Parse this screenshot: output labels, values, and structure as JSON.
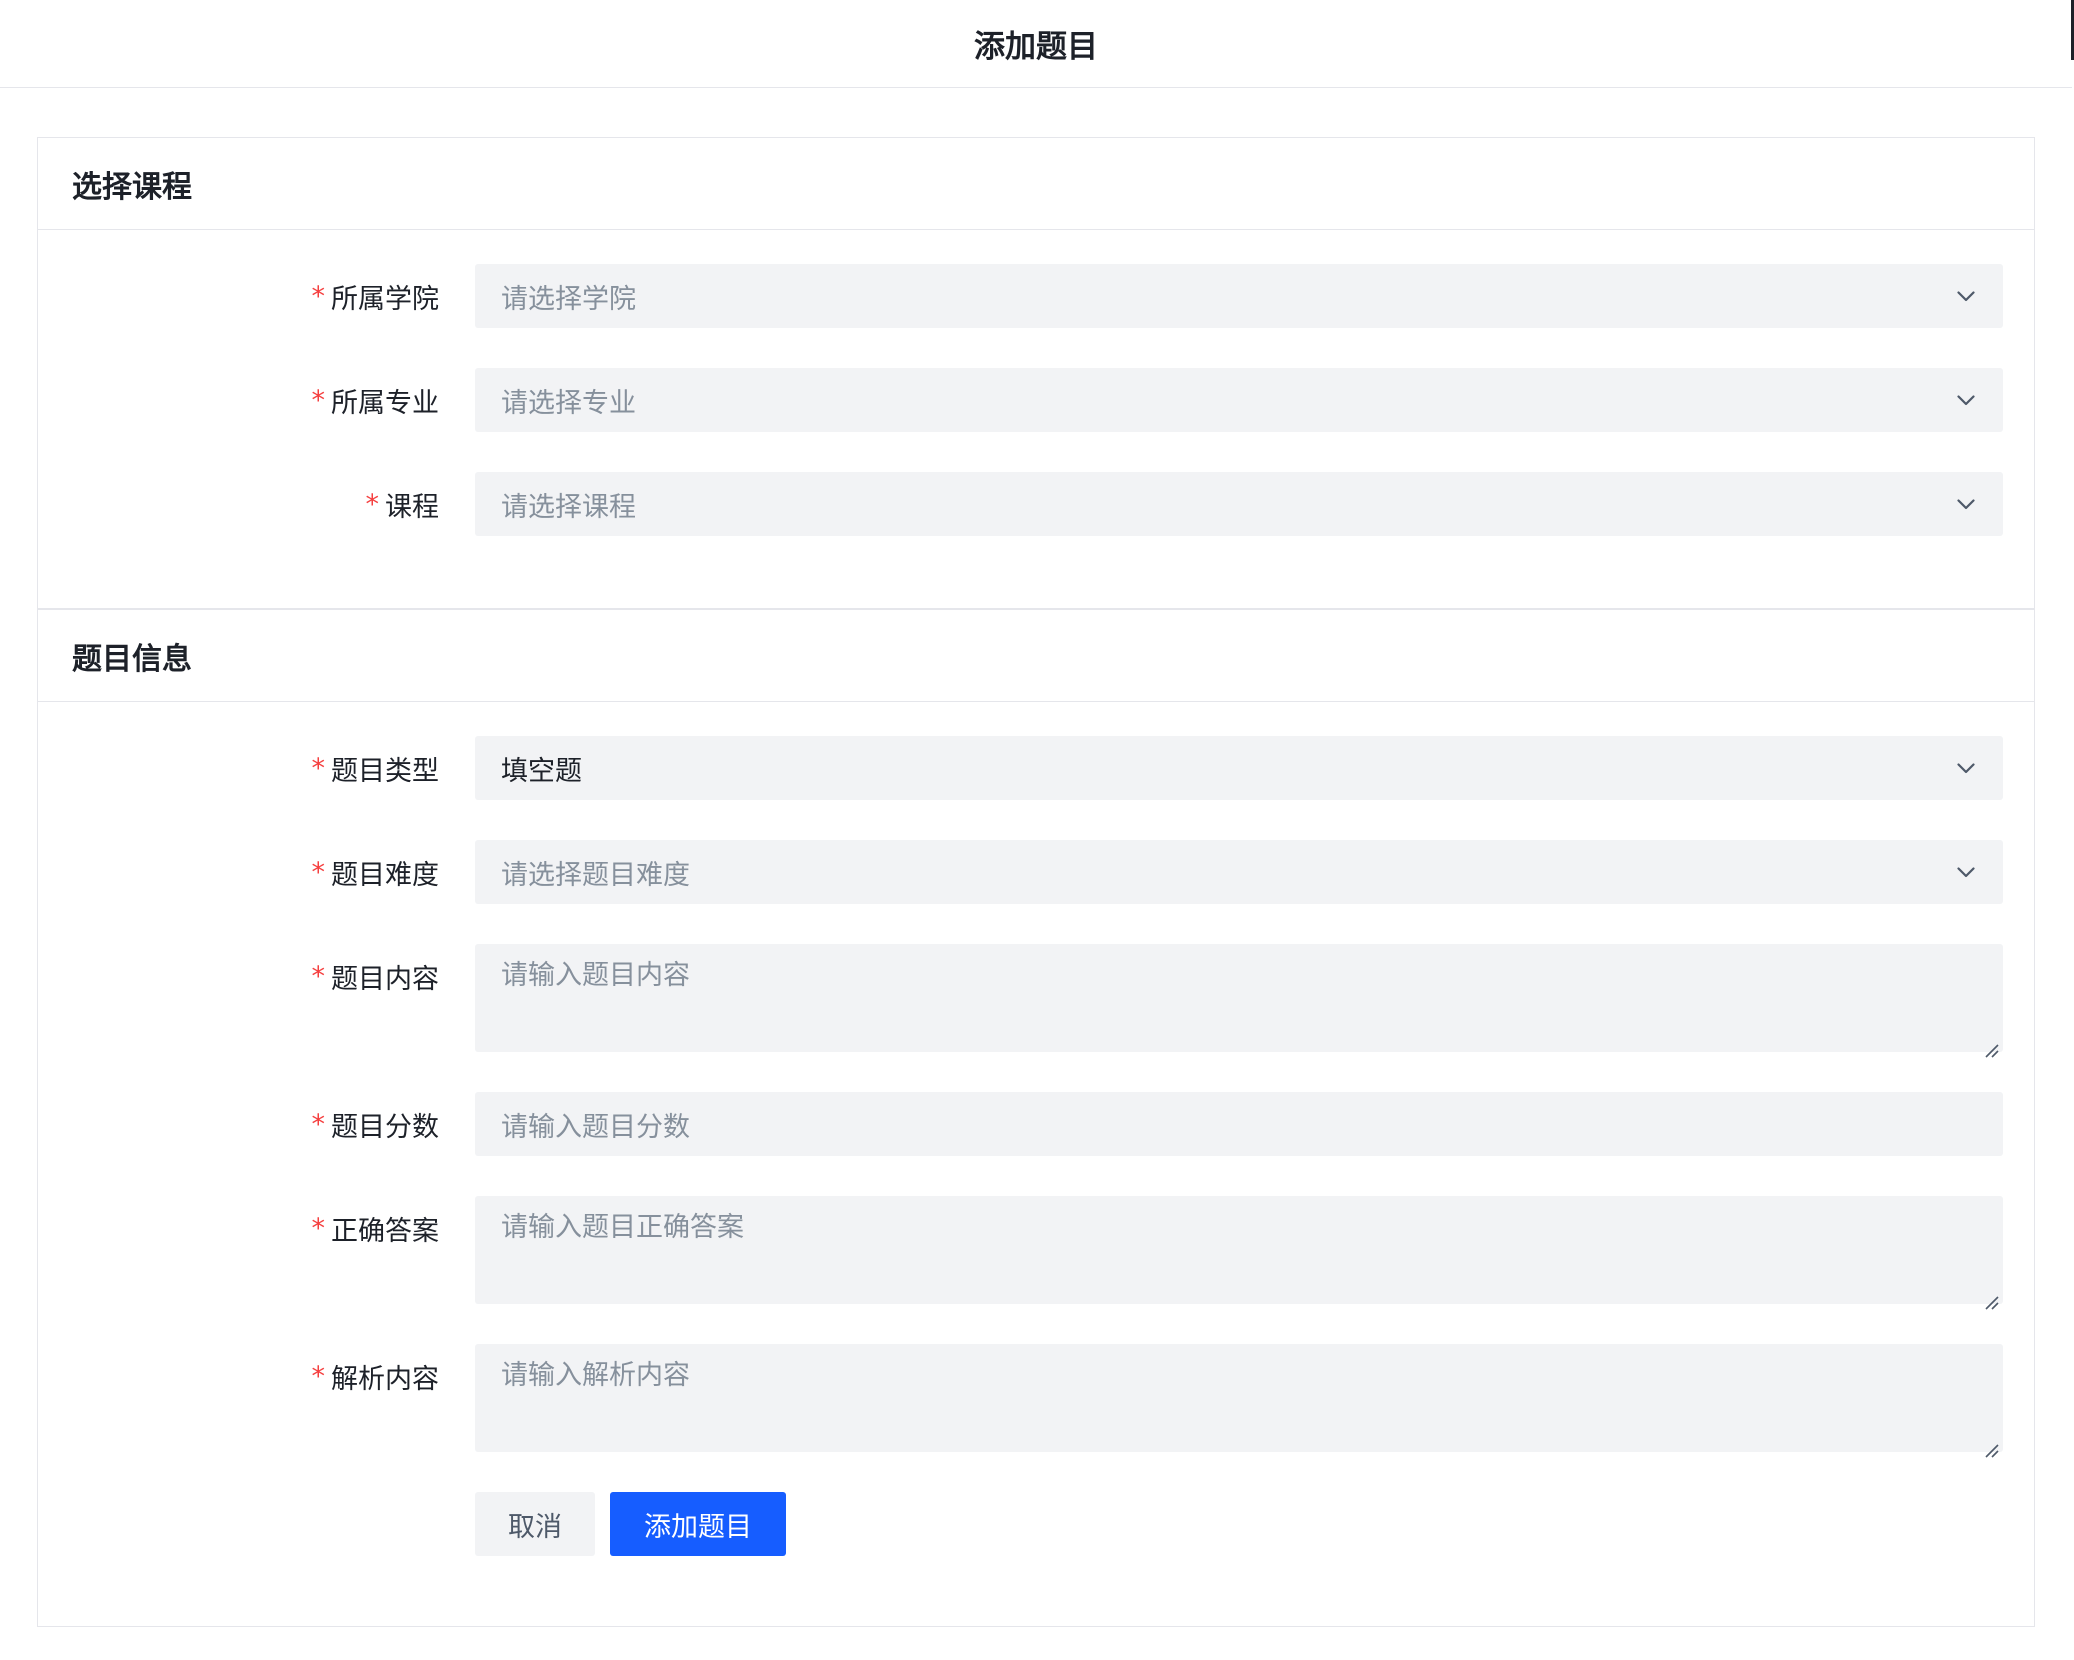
{
  "header": {
    "title": "添加题目"
  },
  "section_course": {
    "title": "选择课程",
    "fields": [
      {
        "label": "所属学院",
        "placeholder": "请选择学院"
      },
      {
        "label": "所属专业",
        "placeholder": "请选择专业"
      },
      {
        "label": "课程",
        "placeholder": "请选择课程"
      }
    ]
  },
  "section_question": {
    "title": "题目信息",
    "type": {
      "label": "题目类型",
      "value": "填空题"
    },
    "difficulty": {
      "label": "题目难度",
      "placeholder": "请选择题目难度"
    },
    "content": {
      "label": "题目内容",
      "placeholder": "请输入题目内容"
    },
    "score": {
      "label": "题目分数",
      "placeholder": "请输入题目分数"
    },
    "answer": {
      "label": "正确答案",
      "placeholder": "请输入题目正确答案"
    },
    "analysis": {
      "label": "解析内容",
      "placeholder": "请输入解析内容"
    }
  },
  "required_mark": "*",
  "actions": {
    "cancel": "取消",
    "submit": "添加题目"
  },
  "colors": {
    "primary": "#165dff",
    "required": "#f53f3f",
    "field_bg": "#f2f3f5"
  },
  "icons": {
    "select_arrow": "chevron-down-icon",
    "textarea_resize": "resize-handle-icon"
  }
}
